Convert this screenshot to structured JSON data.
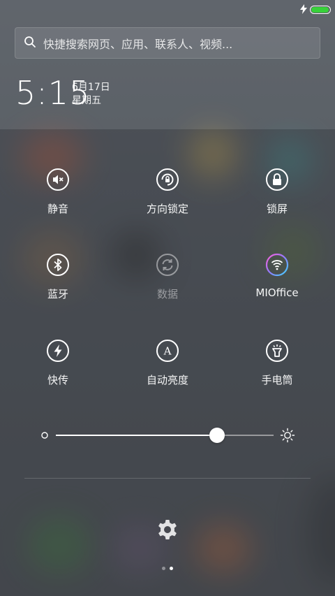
{
  "status_bar": {
    "battery_level": 0.95,
    "battery_color": "#38d13a",
    "charging": true
  },
  "search": {
    "placeholder": "快捷搜索网页、应用、联系人、视频..."
  },
  "clock": {
    "time": "5:15",
    "date": "6月17日",
    "weekday": "星期五"
  },
  "toggles": [
    {
      "label": "静音",
      "icon": "mute-icon",
      "state": "on"
    },
    {
      "label": "方向锁定",
      "icon": "rotation-lock-icon",
      "state": "on"
    },
    {
      "label": "锁屏",
      "icon": "lock-icon",
      "state": "on"
    },
    {
      "label": "蓝牙",
      "icon": "bluetooth-icon",
      "state": "on"
    },
    {
      "label": "数据",
      "icon": "data-sync-icon",
      "state": "off"
    },
    {
      "label": "MIOffice",
      "icon": "wifi-icon",
      "state": "active"
    },
    {
      "label": "快传",
      "icon": "quick-transfer-icon",
      "state": "on"
    },
    {
      "label": "自动亮度",
      "icon": "auto-brightness-icon",
      "state": "on"
    },
    {
      "label": "手电筒",
      "icon": "flashlight-icon",
      "state": "on"
    }
  ],
  "brightness": {
    "level": 0.74
  },
  "pager": {
    "pages": 2,
    "current": 2
  }
}
